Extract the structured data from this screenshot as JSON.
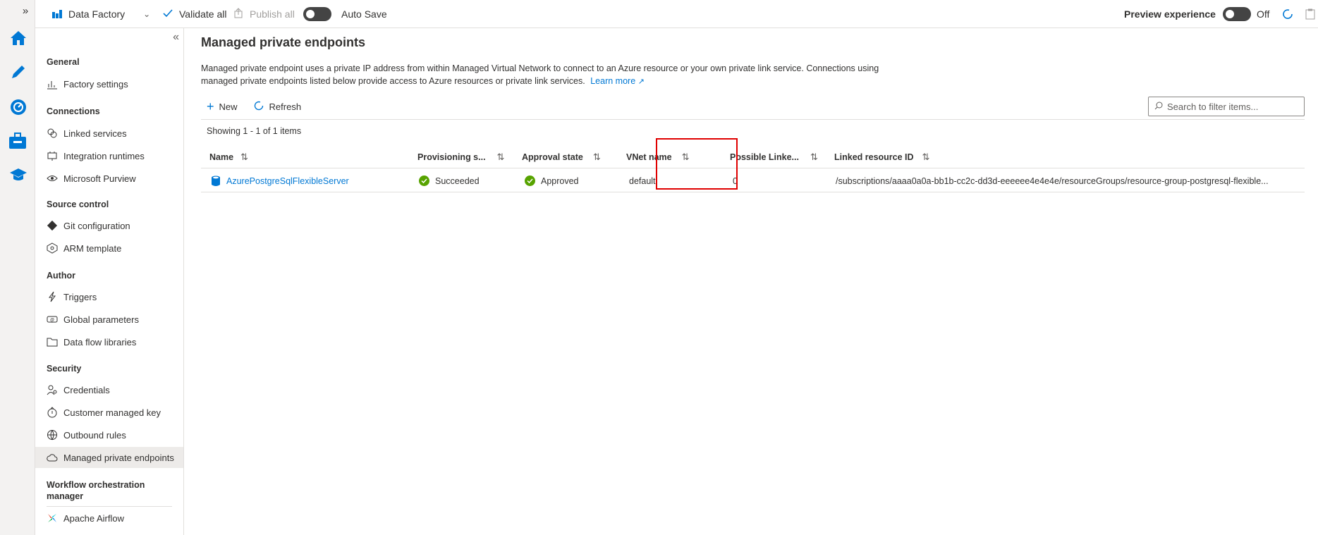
{
  "topbar": {
    "factory_label": "Data Factory",
    "validate_label": "Validate all",
    "publish_label": "Publish all",
    "autosave_label": "Auto Save",
    "preview_label": "Preview experience",
    "preview_state": "Off"
  },
  "sidebar": {
    "sections": {
      "general": "General",
      "connections": "Connections",
      "source_control": "Source control",
      "author": "Author",
      "security": "Security",
      "workflow": "Workflow orchestration manager"
    },
    "items": {
      "factory_settings": "Factory settings",
      "linked_services": "Linked services",
      "integration_runtimes": "Integration runtimes",
      "microsoft_purview": "Microsoft Purview",
      "git_configuration": "Git configuration",
      "arm_template": "ARM template",
      "triggers": "Triggers",
      "global_parameters": "Global parameters",
      "data_flow_libraries": "Data flow libraries",
      "credentials": "Credentials",
      "customer_managed_key": "Customer managed key",
      "outbound_rules": "Outbound rules",
      "managed_private_endpoints": "Managed private endpoints",
      "apache_airflow": "Apache Airflow"
    },
    "active_item": "Managed private endpoints"
  },
  "main": {
    "title": "Managed private endpoints",
    "description_1": "Managed private endpoint uses a private IP address from within Managed Virtual Network to connect to an Azure resource or your own private link service. Connections using",
    "description_2": "managed private endpoints listed below provide access to Azure resources or private link services.",
    "learn_more": "Learn more",
    "new_label": "New",
    "refresh_label": "Refresh",
    "filter_placeholder": "Search to filter items...",
    "showing": "Showing 1 - 1 of 1 items"
  },
  "table": {
    "headers": {
      "name": "Name",
      "provisioning": "Provisioning s...",
      "approval": "Approval state",
      "vnet": "VNet name",
      "possible": "Possible Linke...",
      "resource_id": "Linked resource ID"
    },
    "rows": [
      {
        "name": "AzurePostgreSqlFlexibleServer",
        "provisioning": "Succeeded",
        "approval": "Approved",
        "vnet": "default",
        "possible": "0",
        "resource_id": "/subscriptions/aaaa0a0a-bb1b-cc2c-dd3d-eeeeee4e4e4e/resourceGroups/resource-group-postgresql-flexible..."
      }
    ]
  },
  "colors": {
    "accent": "#0078d4",
    "success": "#57a300",
    "highlight": "#e00000"
  }
}
